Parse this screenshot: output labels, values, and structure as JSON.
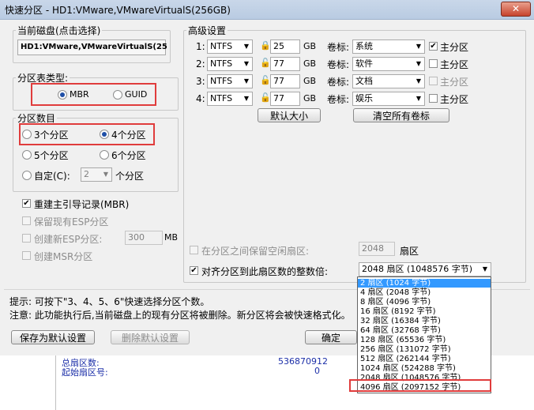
{
  "window": {
    "title": "快速分区 - HD1:VMware,VMwareVirtualS(256GB)",
    "close_glyph": "✕"
  },
  "current_disk": {
    "label": "当前磁盘(点击选择)",
    "value": "HD1:VMware,VMwareVirtualS(25"
  },
  "partition_table": {
    "label": "分区表类型:",
    "mbr": "MBR",
    "guid": "GUID",
    "selected": "MBR"
  },
  "partition_count": {
    "label": "分区数目",
    "options": [
      "3个分区",
      "4个分区",
      "5个分区",
      "6个分区"
    ],
    "selected": "4个分区",
    "custom_label": "自定(C):",
    "custom_value": "2",
    "custom_suffix": "个分区"
  },
  "options": {
    "rebuild_mbr": "重建主引导记录(MBR)",
    "keep_esp": "保留现有ESP分区",
    "create_esp": "创建新ESP分区:",
    "esp_size": "300",
    "esp_unit": "MB",
    "create_msr": "创建MSR分区"
  },
  "advanced": {
    "label": "高级设置",
    "size_unit": "GB",
    "volume_label": "卷标:",
    "primary_label": "主分区",
    "rows": [
      {
        "num": "1:",
        "fs": "NTFS",
        "size": "25",
        "volume": "系统",
        "primary": true
      },
      {
        "num": "2:",
        "fs": "NTFS",
        "size": "77",
        "volume": "软件",
        "primary": false
      },
      {
        "num": "3:",
        "fs": "NTFS",
        "size": "77",
        "volume": "文档",
        "primary": false
      },
      {
        "num": "4:",
        "fs": "NTFS",
        "size": "77",
        "volume": "娱乐",
        "primary": false
      }
    ],
    "default_size_button": "默认大小",
    "clear_labels_button": "清空所有卷标",
    "reserve_sectors_label": "在分区之间保留空闲扇区:",
    "reserve_sectors_value": "2048",
    "reserve_sectors_unit": "扇区",
    "align_label": "对齐分区到此扇区数的整数倍:",
    "align_value": "2048 扇区 (1048576 字节)"
  },
  "align_options": [
    "2 扇区 (1024 字节)",
    "4 扇区 (2048 字节)",
    "8 扇区 (4096 字节)",
    "16 扇区 (8192 字节)",
    "32 扇区 (16384 字节)",
    "64 扇区 (32768 字节)",
    "128 扇区 (65536 字节)",
    "256 扇区 (131072 字节)",
    "512 扇区 (262144 字节)",
    "1024 扇区 (524288 字节)",
    "2048 扇区 (1048576 字节)",
    "4096 扇区 (2097152 字节)"
  ],
  "hints": {
    "tip": "提示: 可按下\"3、4、5、6\"快速选择分区个数。",
    "note": "注意: 此功能执行后,当前磁盘上的现有分区将被删除。新分区将会被快速格式化。"
  },
  "buttons": {
    "save_default": "保存为默认设置",
    "delete_default": "删除默认设置",
    "ok": "确定"
  },
  "background": {
    "total_sectors_label": "总扇区数:",
    "total_sectors_value": "536870912",
    "start_sector_label": "起始扇区号:",
    "start_sector_value": "0"
  },
  "colors": {
    "highlight_box": "#e03c3c",
    "selection": "#3399ff",
    "info_text": "#1c2fa8"
  }
}
